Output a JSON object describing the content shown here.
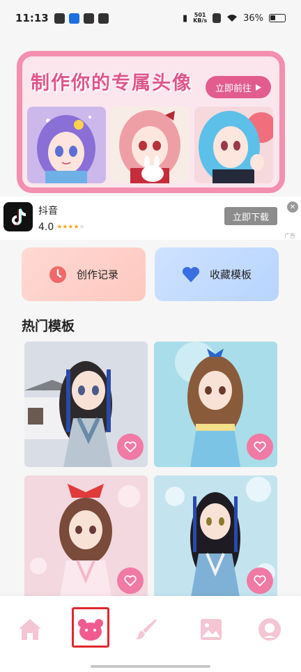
{
  "status": {
    "time": "11:13",
    "net_speed": "501",
    "net_unit": "KB/s",
    "battery": "36%"
  },
  "banner": {
    "title": "制作你的专属头像",
    "button": "立即前往"
  },
  "ad": {
    "app_name": "抖音",
    "rating": "4.0",
    "download": "立即下载",
    "tag": "广告"
  },
  "quick": {
    "records": "创作记录",
    "favorites": "收藏模板"
  },
  "section": {
    "hot_templates": "热门模板"
  },
  "icons": [
    "home-icon",
    "bear-icon",
    "brush-icon",
    "image-icon",
    "avatar-icon",
    "heart-icon"
  ],
  "colors": {
    "accent": "#e25d8e",
    "nav_active": "#f25b8f",
    "nav_inactive": "#f4c5d2",
    "heart_btn": "#f07aa4"
  }
}
